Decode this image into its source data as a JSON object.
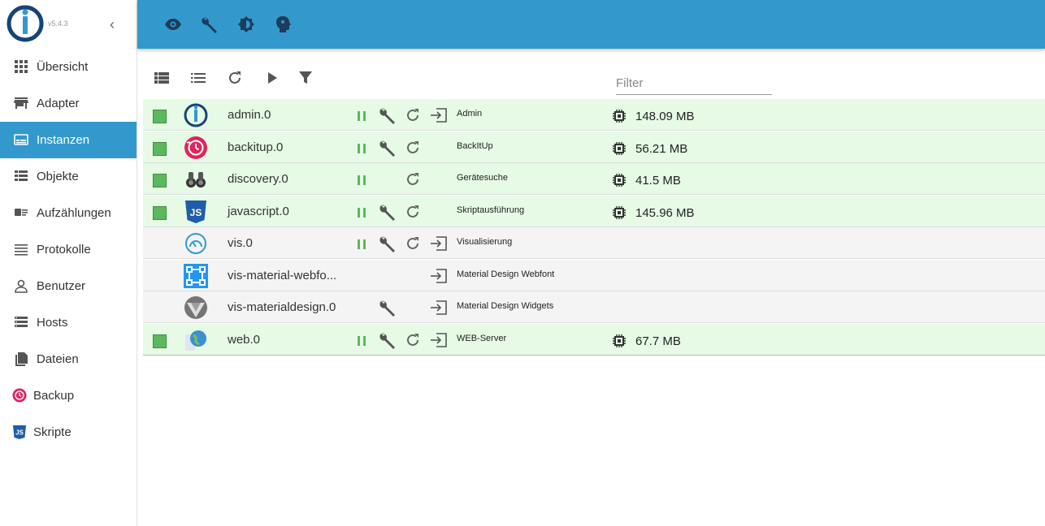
{
  "app": {
    "version": "v5.4.3"
  },
  "colors": {
    "primary": "#3399cc",
    "running_row": "#e6fae6",
    "stopped_row": "#f4f4f4",
    "checkbox": "#5cb85c",
    "action_green": "#5cb85c"
  },
  "sidebar": {
    "collapse_icon": "chevron-left-icon",
    "items": [
      {
        "label": "Übersicht",
        "icon": "grid-icon",
        "active": false
      },
      {
        "label": "Adapter",
        "icon": "store-icon",
        "active": false
      },
      {
        "label": "Instanzen",
        "icon": "instances-icon",
        "active": true
      },
      {
        "label": "Objekte",
        "icon": "list-view-icon",
        "active": false
      },
      {
        "label": "Aufzählungen",
        "icon": "enum-icon",
        "active": false
      },
      {
        "label": "Protokolle",
        "icon": "lines-icon",
        "active": false
      },
      {
        "label": "Benutzer",
        "icon": "user-icon",
        "active": false
      },
      {
        "label": "Hosts",
        "icon": "hosts-icon",
        "active": false
      },
      {
        "label": "Dateien",
        "icon": "files-icon",
        "active": false
      },
      {
        "label": "Backup",
        "icon": "backup-icon",
        "active": false
      },
      {
        "label": "Skripte",
        "icon": "js-icon",
        "active": false
      }
    ]
  },
  "topbar": {
    "icons": [
      "eye-icon",
      "wrench-icon",
      "brightness-icon",
      "expert-head-icon"
    ]
  },
  "toolbar": {
    "icons": [
      "table-view-icon",
      "list-view-icon",
      "refresh-icon",
      "play-icon",
      "filter-icon"
    ],
    "filter": {
      "placeholder": "Filter",
      "value": ""
    }
  },
  "instances": [
    {
      "name": "admin.0",
      "title": "Admin",
      "memory": "148.09 MB",
      "running": true,
      "enabled": true,
      "icon": "admin-icon",
      "actions": {
        "pause": true,
        "settings": true,
        "restart": true,
        "link": true
      }
    },
    {
      "name": "backitup.0",
      "title": "BackItUp",
      "memory": "56.21 MB",
      "running": true,
      "enabled": true,
      "icon": "backitup-icon",
      "actions": {
        "pause": true,
        "settings": true,
        "restart": true,
        "link": false
      }
    },
    {
      "name": "discovery.0",
      "title": "Gerätesuche",
      "memory": "41.5 MB",
      "running": true,
      "enabled": true,
      "icon": "binoculars-icon",
      "actions": {
        "pause": true,
        "settings": false,
        "restart": true,
        "link": false
      }
    },
    {
      "name": "javascript.0",
      "title": "Skriptausführung",
      "memory": "145.96 MB",
      "running": true,
      "enabled": true,
      "icon": "javascript-icon",
      "actions": {
        "pause": true,
        "settings": true,
        "restart": true,
        "link": false
      }
    },
    {
      "name": "vis.0",
      "title": "Visualisierung",
      "memory": "",
      "running": false,
      "enabled": false,
      "icon": "gauge-icon",
      "actions": {
        "pause": true,
        "settings": true,
        "restart": true,
        "link": true
      }
    },
    {
      "name": "vis-material-webfo...",
      "title": "Material Design Webfont",
      "memory": "",
      "running": false,
      "enabled": false,
      "icon": "vector-square-icon",
      "actions": {
        "pause": false,
        "settings": false,
        "restart": false,
        "link": true
      }
    },
    {
      "name": "vis-materialdesign.0",
      "title": "Material Design Widgets",
      "memory": "",
      "running": false,
      "enabled": false,
      "icon": "material-design-icon",
      "actions": {
        "pause": false,
        "settings": true,
        "restart": false,
        "link": true
      }
    },
    {
      "name": "web.0",
      "title": "WEB-Server",
      "memory": "67.7 MB",
      "running": true,
      "enabled": true,
      "icon": "web-globe-icon",
      "actions": {
        "pause": true,
        "settings": true,
        "restart": true,
        "link": true
      }
    }
  ]
}
